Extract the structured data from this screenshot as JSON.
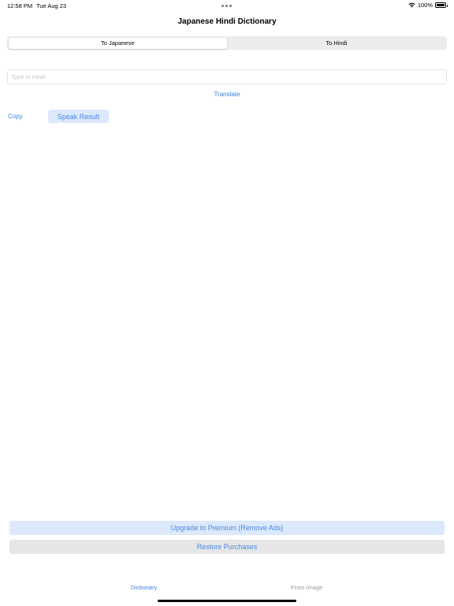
{
  "status_bar": {
    "time": "12:58 PM",
    "date": "Tue Aug 23",
    "battery": "100%",
    "battery_level": 1.0,
    "icons": [
      "wifi-icon",
      "battery-icon",
      "multitasking-dots-icon"
    ]
  },
  "nav": {
    "title": "Japanese Hindi Dictionary"
  },
  "segmented": {
    "options": [
      "To Japanese",
      "To Hindi"
    ],
    "selected": "To Japanese"
  },
  "input": {
    "value": "",
    "placeholder": "Type In Hindi"
  },
  "actions": {
    "translate": "Translate",
    "copy": "Copy",
    "speak": "Speak Result"
  },
  "purchase": {
    "upgrade": "Upgrade to Premium (Remove Ads)",
    "restore": "Restore Purchases"
  },
  "tabs": {
    "items": [
      "Dictionary",
      "From Image"
    ],
    "selected": "Dictionary"
  },
  "colors": {
    "accent": "#3b82d9",
    "accent_light_bg": "#dce8fb",
    "inactive_tab": "#9a9a9e"
  }
}
